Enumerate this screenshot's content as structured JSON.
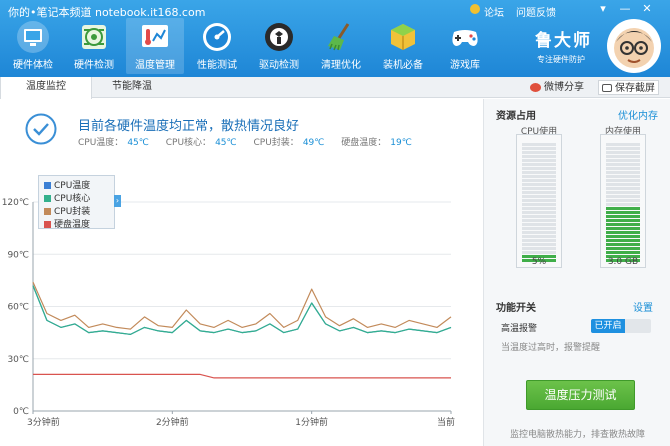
{
  "watermark": "你的•笔记本频道 notebook.it168.com",
  "header": {
    "links": [
      "论坛",
      "问题反馈"
    ],
    "brand_name": "鲁大师",
    "brand_slogan": "专注硬件防护",
    "colors": {
      "header_top": "#3aa5e8",
      "header_bottom": "#1e86d6"
    }
  },
  "toolbar": {
    "items": [
      {
        "label": "硬件体检",
        "icon": "computer-monitor-icon"
      },
      {
        "label": "硬件检测",
        "icon": "circuit-board-icon"
      },
      {
        "label": "温度管理",
        "icon": "thermometer-chart-icon",
        "active": true
      },
      {
        "label": "性能测试",
        "icon": "speedometer-icon"
      },
      {
        "label": "驱动检测",
        "icon": "driver-gear-icon"
      },
      {
        "label": "清理优化",
        "icon": "broom-icon"
      },
      {
        "label": "装机必备",
        "icon": "software-box-icon"
      },
      {
        "label": "游戏库",
        "icon": "gamepad-icon"
      }
    ]
  },
  "tabs": [
    {
      "label": "温度监控",
      "active": true
    },
    {
      "label": "节能降温",
      "active": false
    }
  ],
  "tab_actions": {
    "share": "微博分享",
    "screenshot": "保存截屏"
  },
  "status": {
    "title": "目前各硬件温度均正常，散热情况良好",
    "metrics": [
      {
        "label": "CPU温度：",
        "value": "45℃"
      },
      {
        "label": "CPU核心：",
        "value": "45℃"
      },
      {
        "label": "CPU封装：",
        "value": "49℃"
      },
      {
        "label": "硬盘温度：",
        "value": "19℃"
      }
    ]
  },
  "chart_data": {
    "type": "line",
    "x_ticks": [
      "3分钟前",
      "2分钟前",
      "1分钟前",
      "当前"
    ],
    "y_ticks": [
      "0℃",
      "30℃",
      "60℃",
      "90℃",
      "120℃"
    ],
    "ylim": [
      0,
      120
    ],
    "grid": true,
    "legend_position": "top-left",
    "x": [
      0,
      6,
      12,
      18,
      24,
      30,
      36,
      42,
      48,
      54,
      60,
      66,
      72,
      78,
      84,
      90,
      96,
      102,
      108,
      114,
      120,
      126,
      132,
      138,
      144,
      150,
      156,
      162,
      168,
      174,
      180
    ],
    "series": [
      {
        "name": "CPU温度",
        "color": "#3b7fd4",
        "values": [
          72,
          52,
          48,
          50,
          45,
          46,
          45,
          44,
          48,
          46,
          45,
          52,
          46,
          45,
          47,
          45,
          46,
          50,
          45,
          47,
          62,
          50,
          46,
          48,
          45,
          46,
          45,
          47,
          46,
          45,
          48
        ]
      },
      {
        "name": "CPU核心",
        "color": "#33b08c",
        "values": [
          72,
          52,
          48,
          50,
          45,
          46,
          45,
          44,
          48,
          46,
          45,
          52,
          46,
          45,
          47,
          45,
          46,
          50,
          45,
          47,
          62,
          50,
          46,
          48,
          45,
          46,
          45,
          47,
          46,
          45,
          48
        ]
      },
      {
        "name": "CPU封装",
        "color": "#c28a5a",
        "values": [
          74,
          56,
          52,
          55,
          48,
          50,
          48,
          47,
          54,
          49,
          48,
          58,
          50,
          48,
          52,
          48,
          50,
          56,
          48,
          52,
          70,
          54,
          49,
          53,
          48,
          50,
          48,
          52,
          50,
          48,
          54
        ]
      },
      {
        "name": "硬盘温度",
        "color": "#d9534f",
        "values": [
          21,
          21,
          21,
          21,
          21,
          21,
          21,
          21,
          21,
          21,
          21,
          21,
          21,
          19,
          19,
          19,
          19,
          19,
          19,
          19,
          19,
          19,
          19,
          19,
          19,
          19,
          19,
          19,
          19,
          19,
          19
        ]
      }
    ]
  },
  "resources": {
    "title": "资源占用",
    "optimize_link": "优化内存",
    "cpu": {
      "label": "CPU使用",
      "value_text": "5%",
      "fill_fraction": 0.05
    },
    "memory": {
      "label": "内存使用",
      "value_text": "3.0 GB",
      "fill_fraction": 0.45
    },
    "bar_color": "#3fae49"
  },
  "function_switch": {
    "title": "功能开关",
    "settings_link": "设置",
    "alarm_label": "高温报警",
    "alarm_state": "已开启",
    "alarm_hint": "当温度过高时，报警提醒"
  },
  "stress_button": "温度压力测试",
  "footer_hint": "监控电脑散热能力，排查散热故障"
}
